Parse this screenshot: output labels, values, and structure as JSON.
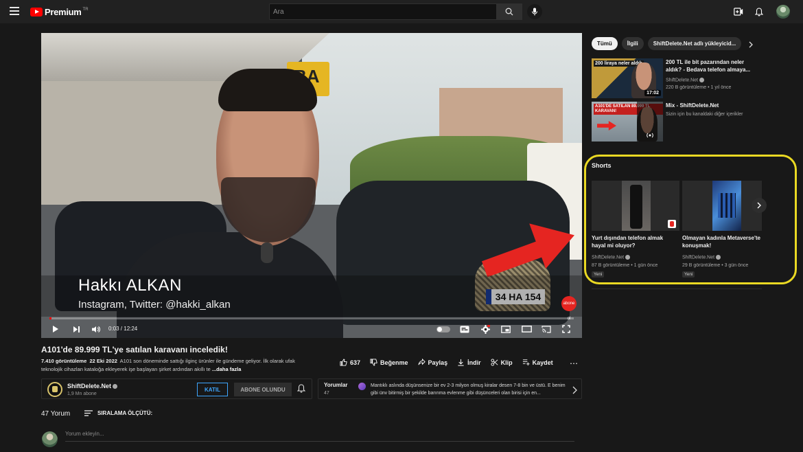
{
  "header": {
    "logo_text": "Premium",
    "logo_country": "TR",
    "search_placeholder": "Ara",
    "icons": [
      "menu-icon",
      "search-icon",
      "mic-icon",
      "create-video-icon",
      "notifications-bell-icon",
      "account-avatar"
    ]
  },
  "player": {
    "overlay_name": "Hakkı ALKAN",
    "overlay_social": "Instagram, Twitter: @hakki_alkan",
    "sign_text": "BA",
    "plate_text": "34 HA 154",
    "corner_logo": "abone ol",
    "time_current": "0:03",
    "time_total": "12:24",
    "time_display": "0:03 / 12:24",
    "progress_fraction": 0.004
  },
  "video": {
    "title": "A101'de 89.999 TL'ye satılan karavanı inceledik!",
    "views": "7.410 görüntüleme",
    "date": "22 Eki 2022",
    "description": "A101 son döneminde sattığı ilginç ürünler ile gündeme geliyor. İlk olarak ufak teknolojik cihazlan kataloğa ekleyerek işe başlayan şirket ardından akıllı te",
    "more_label": "...daha fazla",
    "actions": {
      "like_count": "637",
      "dislike_label": "Beğenme",
      "share_label": "Paylaş",
      "download_label": "İndir",
      "clip_label": "Klip",
      "save_label": "Kaydet"
    }
  },
  "channel": {
    "name": "ShiftDelete.Net",
    "subscribers": "1,9 Mn abone",
    "join_label": "KATIL",
    "subscribed_label": "ABONE OLUNDU"
  },
  "comments_teaser": {
    "title": "Yorumlar",
    "count": "47",
    "text": "Mantıklı aslında düşünsenize bir ev 2-3 milyon olmuş kiralar desen 7-8 bin ve üstü. E benim gibi ünv bitirmiş bir şekilde barınma evlenme gibi düşünceleri olan birisi için en..."
  },
  "comments": {
    "count_label": "47 Yorum",
    "sort_label": "SIRALAMA ÖLÇÜTÜ:",
    "add_placeholder": "Yorum ekleyin..."
  },
  "sidebar": {
    "chips": [
      "Tümü",
      "İlgili",
      "ShiftDelete.Net adlı yükleyicid..."
    ],
    "recommendations": [
      {
        "title": "200 TL ile bit pazarından neler aldık? - Bedava telefon almaya...",
        "channel": "ShiftDelete.Net",
        "meta": "220 B görüntüleme • 1 yıl önce",
        "duration": "17:02",
        "thumb_label": "200 liraya neler aldık"
      },
      {
        "title": "Mix - ShiftDelete.Net",
        "channel": "",
        "meta": "Sizin için bu kanaldaki diğer içerikler",
        "duration": "",
        "thumb_label": "A101'DE SATILAN 89.999 TL KARAVAN!"
      }
    ],
    "shorts": {
      "title": "Shorts",
      "items": [
        {
          "title": "Yurt dışından telefon almak hayal mi oluyor?",
          "channel": "ShiftDelete.Net",
          "meta": "87 B görüntüleme • 1 gün önce",
          "badge": "Yeni"
        },
        {
          "title": "Olmayan kadınla Metaverse'te konuşmak!",
          "channel": "ShiftDelete.Net",
          "meta": "29 B görüntüleme • 3 gün önce",
          "badge": "Yeni"
        }
      ]
    }
  },
  "colors": {
    "background": "#181818",
    "topbar": "#212121",
    "accent_red": "#ff0000",
    "link_blue": "#3ea6ff",
    "highlight_yellow": "#ead923"
  }
}
